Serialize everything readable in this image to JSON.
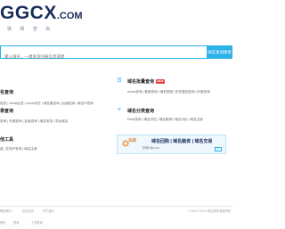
{
  "brand": {
    "logo_main": "GGCX",
    "logo_tld": ".COM",
    "logo_sub": "歌 网 查 询"
  },
  "search": {
    "placeholder": "输入域名，一键查询注册信息或者",
    "button": "域名查询搜索"
  },
  "sections": {
    "whois": {
      "title": "名查询",
      "links": "信息 | whois反查 | whois历史 | 域名值查询 | 后缀查询 | 域名IP查询"
    },
    "bulk": {
      "title": "域名批量查询",
      "badge": "NEW",
      "links": "whois查询 | 备案查询 | 域名快照 | 历史建站查询 | 外链查询"
    },
    "seo": {
      "title": "录查询",
      "links": "查询 | 外链查询 | 反链查询 | 域名收录 | 导出域名"
    },
    "tools": {
      "title": "域名分类查询",
      "links": "Rank查询 | 域名评估 | 域名推荐 | 域名对比 | 域名注册"
    },
    "other": {
      "title": "他工具",
      "links": "量 | 在线IP查询 | 域名注册"
    }
  },
  "promo": {
    "logo_text": "乐网",
    "line1": "域名回购 | 域名融资 | 域名交易",
    "line2": "乐网 Ahz.cn",
    "close": "×"
  },
  "footer": {
    "row1": [
      "联系我们",
      "意见反馈",
      "关于我们"
    ],
    "row1_right": "© 2024 GGCX 域名查询 版权所有",
    "row2": [
      "首页",
      "查询",
      "工具查询"
    ]
  },
  "colors": {
    "accent": "#2bb0e8",
    "brand": "#1a2f5c",
    "badge": "#e8413c"
  }
}
